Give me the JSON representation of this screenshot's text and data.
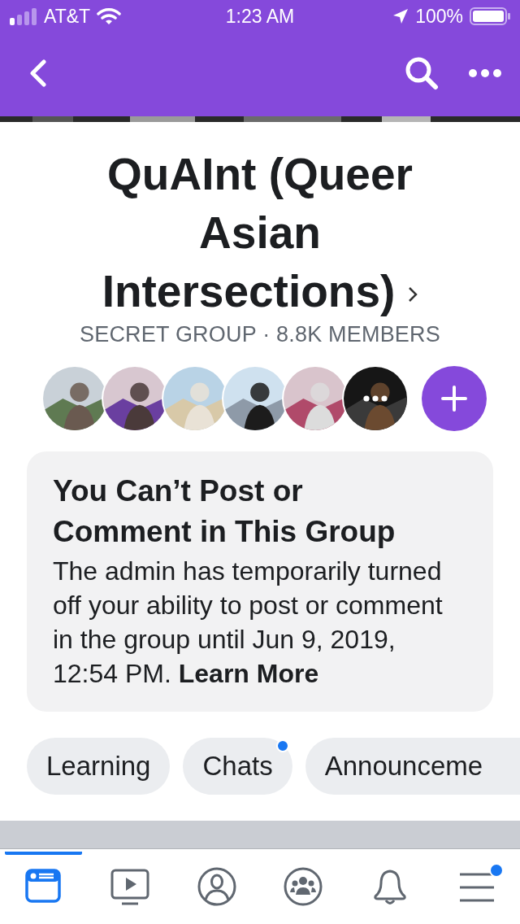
{
  "status_bar": {
    "carrier": "AT&T",
    "time": "1:23 AM",
    "battery": "100%"
  },
  "group": {
    "name": "QuAInt (Queer Asian Intersections)",
    "meta": "SECRET GROUP · 8.8K MEMBERS"
  },
  "members": [
    {
      "kind": "picture"
    },
    {
      "kind": "picture"
    },
    {
      "kind": "picture"
    },
    {
      "kind": "picture"
    },
    {
      "kind": "picture"
    },
    {
      "kind": "more"
    }
  ],
  "notice": {
    "title": "You Can’t Post or Comment in This Group",
    "body": "The admin has temporarily turned off your ability to post or comment in the group until Jun 9, 2019, 12:54 PM.",
    "link": "Learn More"
  },
  "chips": [
    {
      "label": "Learning",
      "badge": false
    },
    {
      "label": "Chats",
      "badge": true
    },
    {
      "label": "Announceme",
      "badge": false
    }
  ],
  "tabs": [
    {
      "kind": "feed",
      "selected": true,
      "badge": false
    },
    {
      "kind": "watch",
      "selected": false,
      "badge": false
    },
    {
      "kind": "profile",
      "selected": false,
      "badge": false
    },
    {
      "kind": "groups",
      "selected": false,
      "badge": false
    },
    {
      "kind": "bell",
      "selected": false,
      "badge": false
    },
    {
      "kind": "menu",
      "selected": false,
      "badge": true
    }
  ]
}
